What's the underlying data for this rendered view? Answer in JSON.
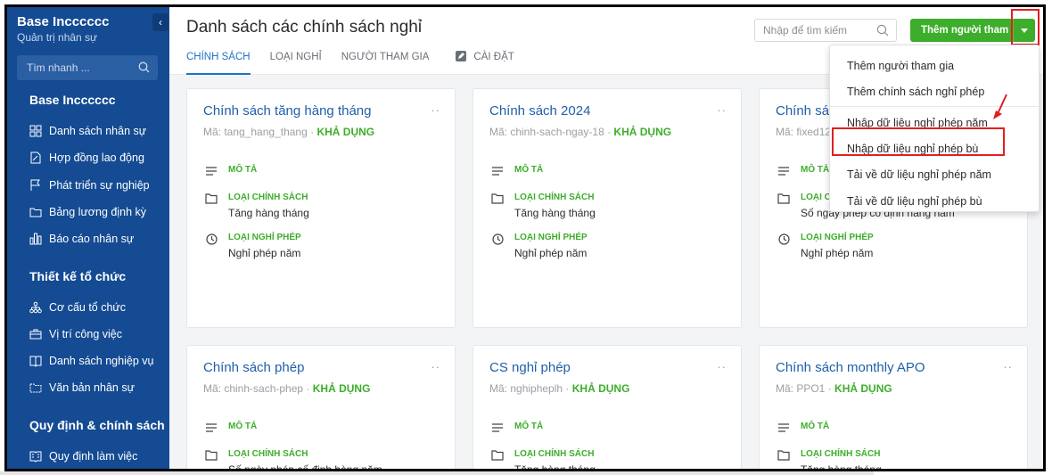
{
  "sidebar": {
    "brand_title": "Base Incccccc",
    "brand_sub": "Quản trị nhân sự",
    "collapse_label": "‹",
    "search_placeholder": "Tìm nhanh ...",
    "groups": [
      {
        "heading": "Base Incccccc",
        "items": [
          "Danh sách nhân sự",
          "Hợp đồng lao động",
          "Phát triển sự nghiệp",
          "Bảng lương định kỳ",
          "Báo cáo nhân sự"
        ]
      },
      {
        "heading": "Thiết kế tổ chức",
        "items": [
          "Cơ cấu tổ chức",
          "Vị trí công việc",
          "Danh sách nghiệp vụ",
          "Văn bản nhân sự"
        ]
      },
      {
        "heading": "Quy định & chính sách",
        "items": [
          "Quy định làm việc"
        ]
      }
    ]
  },
  "header": {
    "title": "Danh sách các chính sách nghỉ",
    "tabs": [
      "CHÍNH SÁCH",
      "LOẠI NGHỈ",
      "NGƯỜI THAM GIA",
      "CÀI ĐẶT"
    ],
    "search_placeholder": "Nhập để tìm kiếm",
    "add_button": "Thêm người tham gia"
  },
  "labels": {
    "description": "MÔ TẢ",
    "policy_type": "LOẠI CHÍNH SÁCH",
    "leave_type": "LOẠI NGHỈ PHÉP",
    "code_prefix": "Mã: ",
    "separator": " · ",
    "more": "··"
  },
  "cards": [
    {
      "title": "Chính sách tăng hàng tháng",
      "code": "tang_hang_thang",
      "status": "KHẢ DỤNG",
      "policy_type": "Tăng hàng tháng",
      "leave_type": "Nghỉ phép năm"
    },
    {
      "title": "Chính sách 2024",
      "code": "chinh-sach-ngay-18",
      "status": "KHẢ DỤNG",
      "policy_type": "Tăng hàng tháng",
      "leave_type": "Nghỉ phép năm"
    },
    {
      "title": "Chính sá",
      "code": "fixed12",
      "status": "",
      "policy_type": "Số ngày phép cố định hàng năm",
      "leave_type": "Nghỉ phép năm"
    },
    {
      "title": "Chính sách phép",
      "code": "chinh-sach-phep",
      "status": "KHẢ DỤNG",
      "policy_type": "Số ngày phép cố định hàng năm",
      "leave_type": ""
    },
    {
      "title": "CS nghỉ phép",
      "code": "nghipheplh",
      "status": "KHẢ DỤNG",
      "policy_type": "Tăng hàng tháng",
      "leave_type": ""
    },
    {
      "title": "Chính sách monthly APO",
      "code": "PPO1",
      "status": "KHẢ DỤNG",
      "policy_type": "Tăng hàng tháng",
      "leave_type": ""
    }
  ],
  "dropdown": {
    "items": [
      "Thêm người tham gia",
      "Thêm chính sách nghỉ phép",
      "Nhập dữ liệu nghỉ phép năm",
      "Nhập dữ liệu nghỉ phép bù",
      "Tải về dữ liệu nghỉ phép năm",
      "Tải về dữ liệu nghỉ phép bù"
    ]
  },
  "colors": {
    "sidebar_bg": "#144b93",
    "accent_blue": "#1e73c9",
    "accent_green": "#3dae2b",
    "highlight_red": "#e02020"
  }
}
